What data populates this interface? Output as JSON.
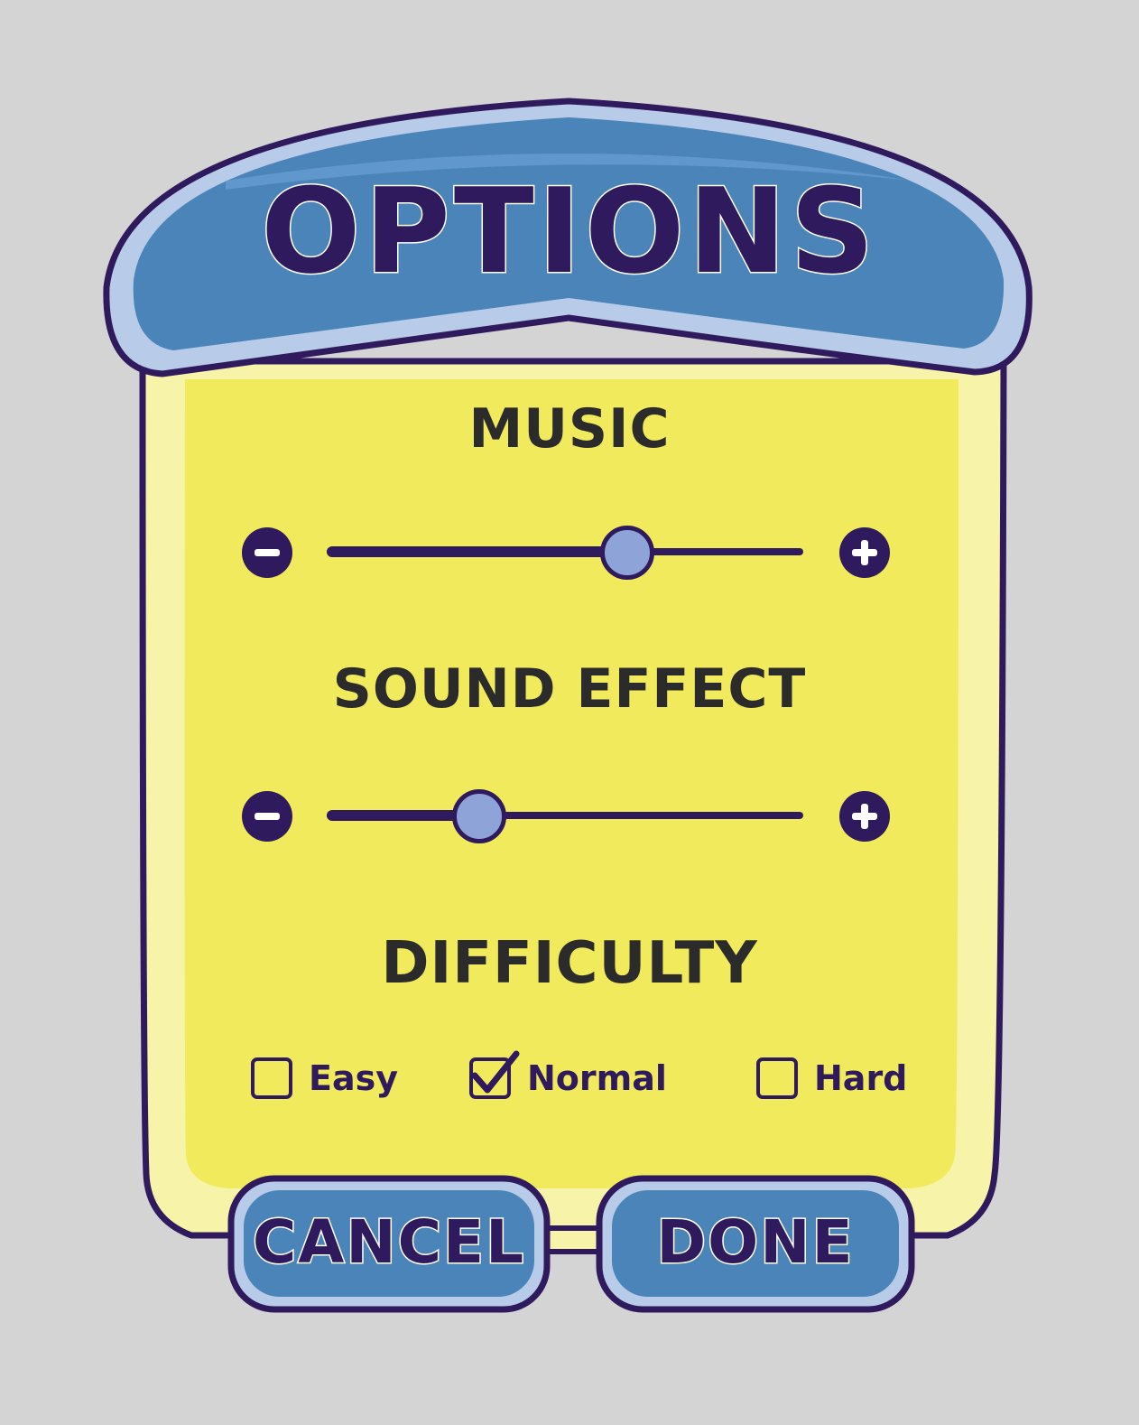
{
  "title": "OPTIONS",
  "music": {
    "label": "MUSIC",
    "level_percent": 63
  },
  "sound_effect": {
    "label": "SOUND EFFECT",
    "level_percent": 32
  },
  "difficulty": {
    "label": "DIFFICULTY",
    "options": [
      {
        "label": "Easy",
        "checked": false
      },
      {
        "label": "Normal",
        "checked": true
      },
      {
        "label": "Hard",
        "checked": false
      }
    ]
  },
  "buttons": {
    "cancel": "CANCEL",
    "done": "DONE"
  },
  "colors": {
    "background": "#d4d4d4",
    "panel": "#f0ea5c",
    "panel_rim": "#f7f3a8",
    "outline": "#2f1a5e",
    "header_blue": "#4a84b8",
    "knob": "#8ea4d8",
    "label_text": "#2b2b2b"
  }
}
